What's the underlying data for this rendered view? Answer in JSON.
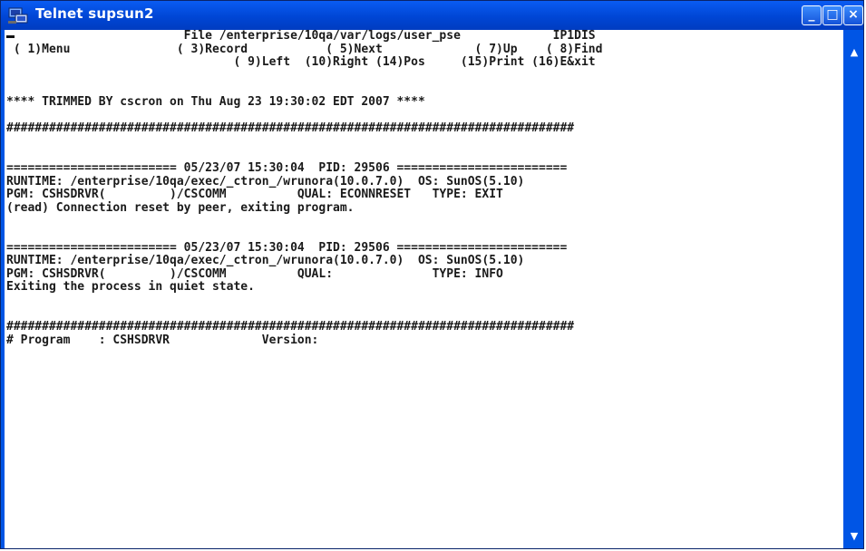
{
  "window": {
    "title": "Telnet supsun2",
    "minimize_glyph": "_",
    "maximize_glyph": "□",
    "close_glyph": "×"
  },
  "scrollbar": {
    "up_glyph": "▲",
    "down_glyph": "▼"
  },
  "terminal": {
    "lines": [
      "                         File /enterprise/10qa/var/logs/user_pse             IP1DIS",
      " ( 1)Menu               ( 3)Record           ( 5)Next             ( 7)Up    ( 8)Find",
      "                                ( 9)Left  (10)Right (14)Pos     (15)Print (16)E&xit",
      "",
      "",
      "**** TRIMMED BY cscron on Thu Aug 23 19:30:02 EDT 2007 ****",
      "",
      "################################################################################",
      "",
      "",
      "======================== 05/23/07 15:30:04  PID: 29506 ========================",
      "RUNTIME: /enterprise/10qa/exec/_ctron_/wrunora(10.0.7.0)  OS: SunOS(5.10)",
      "PGM: CSHSDRVR(         )/CSCOMM          QUAL: ECONNRESET   TYPE: EXIT",
      "(read) Connection reset by peer, exiting program.",
      "",
      "",
      "======================== 05/23/07 15:30:04  PID: 29506 ========================",
      "RUNTIME: /enterprise/10qa/exec/_ctron_/wrunora(10.0.7.0)  OS: SunOS(5.10)",
      "PGM: CSHSDRVR(         )/CSCOMM          QUAL:              TYPE: INFO",
      "Exiting the process in quiet state.",
      "",
      "",
      "################################################################################",
      "# Program    : CSHSDRVR             Version:"
    ]
  }
}
